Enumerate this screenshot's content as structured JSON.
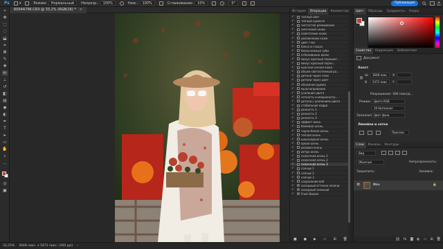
{
  "optionbar": {
    "mode_label": "Режим:",
    "mode_value": "Нормальный",
    "opacity_label": "Непрозр.:",
    "opacity_value": "100%",
    "flow_label": "Наж.:",
    "flow_value": "100%",
    "smoothing_label": "Сглаживание:",
    "smoothing_value": "10%",
    "angle_value": "0°",
    "publish_label": "Публикация"
  },
  "document": {
    "tab_title": "6004A796.CR3 @ 33,2% (RGB/16) *"
  },
  "history": {
    "tabs": [
      "История",
      "Операции",
      "Комментар"
    ],
    "active_tab": 1,
    "items": [
      {
        "label": "теплый свет",
        "folder": false
      },
      {
        "label": "теплый сумеспк",
        "folder": false
      },
      {
        "label": "чистостое размывание",
        "folder": false
      },
      {
        "label": "смягчение кожи",
        "folder": false
      },
      {
        "label": "осветление кожи",
        "folder": false
      },
      {
        "label": "увлажнение кожи",
        "folder": false
      },
      {
        "label": "цвет глаз",
        "folder": false
      },
      {
        "label": "блеск в глазах",
        "folder": false
      },
      {
        "label": "белоснежные зубы",
        "folder": false
      },
      {
        "label": "отбеливание волос",
        "folder": false
      },
      {
        "label": "минус красный перешит...",
        "folder": false
      },
      {
        "label": "минус красный перех...",
        "folder": false
      },
      {
        "label": "красная сочная кожа",
        "folder": false
      },
      {
        "label": "объем светлотемный ро...",
        "folder": false
      },
      {
        "label": "детали через тени",
        "folder": false
      },
      {
        "label": "детали через цвет",
        "folder": false
      },
      {
        "label": "объемная дымка",
        "folder": false
      },
      {
        "label": "мультипрование",
        "folder": false
      },
      {
        "label": "усиление цвета",
        "folder": false
      },
      {
        "label": "четкость и микроконтр...",
        "folder": false
      },
      {
        "label": "детали с усилением цвета",
        "folder": false
      },
      {
        "label": "стабильная кадра",
        "folder": false
      },
      {
        "label": "резкость 1",
        "folder": false
      },
      {
        "label": "резкость 2",
        "folder": false
      },
      {
        "label": "резкость 3",
        "folder": false
      },
      {
        "label": "эффект мена",
        "folder": false
      },
      {
        "label": "бежевая осень",
        "folder": false
      },
      {
        "label": "черно-белая осень",
        "folder": false
      },
      {
        "label": "теплая осень",
        "folder": false
      },
      {
        "label": "шоколадная осень",
        "folder": false
      },
      {
        "label": "яркая осень",
        "folder": false
      },
      {
        "label": "розовая осень",
        "folder": false
      },
      {
        "label": "ретро осень",
        "folder": false
      },
      {
        "label": "сказочная осень 1",
        "folder": false
      },
      {
        "label": "сказочная осень 2",
        "folder": false
      },
      {
        "label": "сказочная осень 3",
        "folder": false
      },
      {
        "label": "солнце 1",
        "folder": false
      },
      {
        "label": "солнце 2",
        "folder": false
      },
      {
        "label": "солнце 3",
        "folder": false
      },
      {
        "label": "сохранение веб",
        "folder": false
      },
      {
        "label": "холодный оттенок зелени",
        "folder": true
      },
      {
        "label": "холодный зеленый",
        "folder": true
      },
      {
        "label": "Fresh Basket",
        "folder": true
      }
    ],
    "selected_index": 35
  },
  "color_panel": {
    "tabs": [
      "Цвет",
      "Образцы",
      "Градиенты",
      "Узоры"
    ],
    "fg": "#c43a32",
    "bg": "#ffffff"
  },
  "properties": {
    "tabs": [
      "Свойства",
      "Коррекция",
      "Библиотеки"
    ],
    "doc_label": "Документ",
    "canvas_head": "Холст",
    "width_label": "Ш",
    "width_value": "3648 пикс",
    "height_label": "В",
    "height_value": "5472 пикс",
    "x_label": "X",
    "y_label": "Y",
    "resolution": "Разрешение: 300 пикс/д...",
    "mode_label": "Режим",
    "mode_value": "Цвета RGB",
    "depth_value": "16 бит/канал",
    "fill_label": "Заполнить",
    "fill_value": "Цвет фона",
    "rulers_head": "Линейки и сетки",
    "units_value": "Пиксели"
  },
  "layers": {
    "tabs": [
      "Слои",
      "Каналы",
      "Контуры"
    ],
    "kind_label": "Вид",
    "blend_value": "Обычные",
    "opacity_label": "Непрозрачность:",
    "lock_label": "Закрепить:",
    "fill_label": "Заливка:",
    "layer_name": "Фон"
  },
  "status": {
    "zoom": "33,25%",
    "size": "3648 пикс. x 5472 пикс. (300 ppi)"
  },
  "colors": {
    "accent": "#1473e6",
    "panel": "#2b2b2b",
    "dark": "#232323"
  }
}
